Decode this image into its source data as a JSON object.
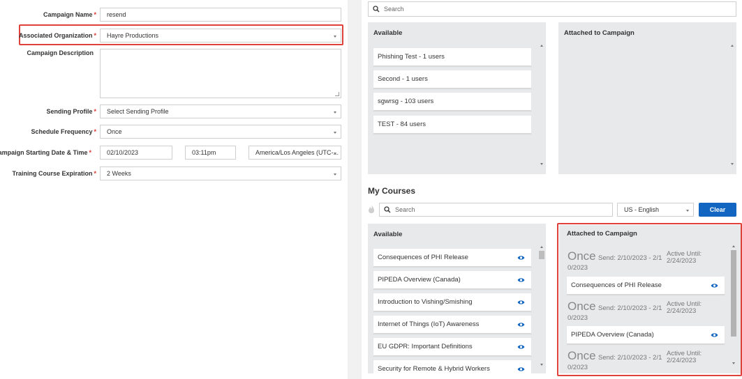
{
  "form": {
    "campaign_name": {
      "label": "Campaign Name",
      "required": "*",
      "value": "resend"
    },
    "organization": {
      "label": "Associated Organization",
      "required": "*",
      "value": "Hayre Productions"
    },
    "description": {
      "label": "Campaign Description",
      "value": ""
    },
    "sending_profile": {
      "label": "Sending Profile",
      "required": "*",
      "value": "Select Sending Profile"
    },
    "schedule_frequency": {
      "label": "Schedule Frequency",
      "required": "*",
      "value": "Once"
    },
    "start": {
      "label": "Campaign Starting Date & Time",
      "required": "*",
      "date": "02/10/2023",
      "time": "03:11pm",
      "timezone": "America/Los Angeles (UTC-..."
    },
    "expiration": {
      "label": "Training Course Expiration",
      "required": "*",
      "value": "2 Weeks"
    }
  },
  "groups": {
    "search_placeholder": "Search",
    "available_title": "Available",
    "attached_title": "Attached to Campaign",
    "available": [
      "Phishing Test - 1 users",
      "Second - 1 users",
      "sgwrsg - 103 users",
      "TEST - 84 users"
    ]
  },
  "courses": {
    "heading": "My Courses",
    "search_placeholder": "Search",
    "language": "US - English",
    "clear_label": "Clear",
    "available_title": "Available",
    "attached_title": "Attached to Campaign",
    "available": [
      "Consequences of PHI Release",
      "PIPEDA Overview (Canada)",
      "Introduction to Vishing/Smishing",
      "Internet of Things (IoT) Awareness",
      "EU GDPR: Important Definitions",
      "Security for Remote & Hybrid Workers"
    ],
    "attached": [
      {
        "freq": "Once",
        "send": "Send: 2/10/2023 - 2/1",
        "send_cont": "0/2023",
        "active": "Active Until: 2/24/2023",
        "course": "Consequences of PHI Release"
      },
      {
        "freq": "Once",
        "send": "Send: 2/10/2023 - 2/1",
        "send_cont": "0/2023",
        "active": "Active Until: 2/24/2023",
        "course": "PIPEDA Overview (Canada)"
      },
      {
        "freq": "Once",
        "send": "Send: 2/10/2023 - 2/1",
        "send_cont": "0/2023",
        "active": "Active Until: 2/24/2023",
        "course": ""
      }
    ]
  },
  "colors": {
    "accent": "#1266c2",
    "highlight": "#e0413b",
    "required": "#d9362f",
    "panel": "#e8e9eb"
  }
}
